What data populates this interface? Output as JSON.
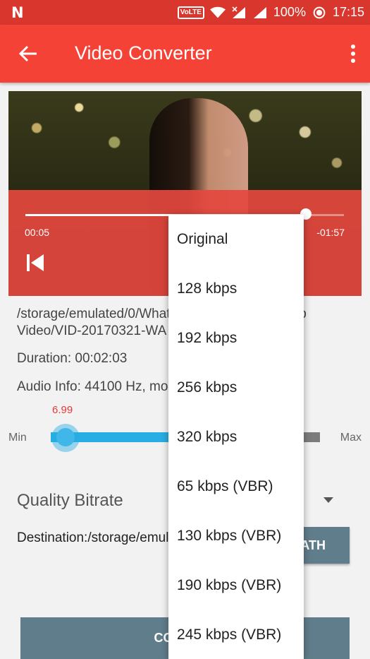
{
  "status_bar": {
    "volte": "VoLTE",
    "battery": "100%",
    "time": "17:15"
  },
  "app_bar": {
    "title": "Video Converter"
  },
  "player": {
    "elapsed": "00:05",
    "remaining": "-01:57",
    "progress": 0.88
  },
  "info": {
    "path": "/storage/emulated/0/WhatsApp/Media/WhatsApp Video/VID-20170321-WA",
    "duration": "Duration: 00:02:03",
    "audio": "Audio Info:  44100 Hz, mono, ..."
  },
  "slider": {
    "value_label": "6.99",
    "min_label": "Min",
    "max_label": "Max",
    "level": 0.04
  },
  "quality": {
    "label": "Quality Bitrate"
  },
  "destination": {
    "text": "Destination:/storage/emulated/0/VideoConverter",
    "path_button": "PATH"
  },
  "convert_button": "CONVERT",
  "bitrate_menu": {
    "options": [
      "Original",
      "128 kbps",
      "192 kbps",
      "256 kbps",
      "320 kbps",
      "65 kbps (VBR)",
      "130 kbps (VBR)",
      "190 kbps (VBR)",
      "245 kbps (VBR)"
    ]
  },
  "colors": {
    "app_bar": "#f44336",
    "status_bar": "#d9372d",
    "slider_accent": "#29aee3",
    "button": "#607d8b"
  },
  "icons": {
    "back": "arrow-back-icon",
    "more": "more-vert-icon",
    "skip_previous": "skip-previous-icon",
    "dropdown": "dropdown-arrow-icon"
  }
}
